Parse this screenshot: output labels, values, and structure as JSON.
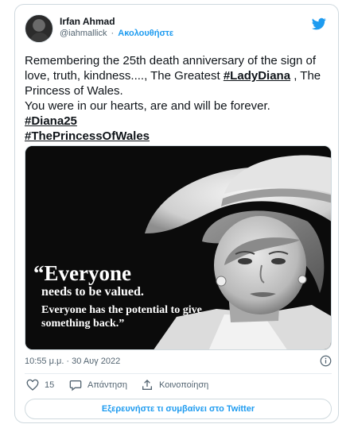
{
  "author": {
    "display_name": "Irfan Ahmad",
    "handle": "@iahmallick",
    "separator": "·",
    "follow_label": "Ακολουθήστε"
  },
  "tweet": {
    "line1_before": "Remembering the 25th death anniversary of the sign of love, truth, kindness...., The Greatest ",
    "tag_ladydiana": "#LadyDiana",
    "line1_after": " , The Princess of Wales.",
    "line2": "You were in our hearts, are and will be forever.",
    "tag_diana25": "#Diana25",
    "tag_princess": "#ThePrincessOfWales"
  },
  "image": {
    "quote_line1": "“Everyone",
    "quote_line2": "needs to be valued.",
    "quote_line3": "Everyone has the potential to give something back.”"
  },
  "meta": {
    "timestamp": "10:55 μ.μ. · 30 Αυγ 2022"
  },
  "actions": {
    "like_count": "15",
    "reply_label": "Απάντηση",
    "share_label": "Κοινοποίηση"
  },
  "footer": {
    "explore_label": "Εξερευνήστε τι συμβαίνει στο Twitter"
  },
  "colors": {
    "twitter_blue": "#1d9bf0",
    "text_primary": "#0f1419",
    "text_secondary": "#536471",
    "border": "#cfd9de"
  },
  "icons": {
    "brand": "twitter-bird-icon",
    "info": "info-icon",
    "like": "heart-icon",
    "reply": "speech-bubble-icon",
    "share": "share-upload-icon"
  }
}
